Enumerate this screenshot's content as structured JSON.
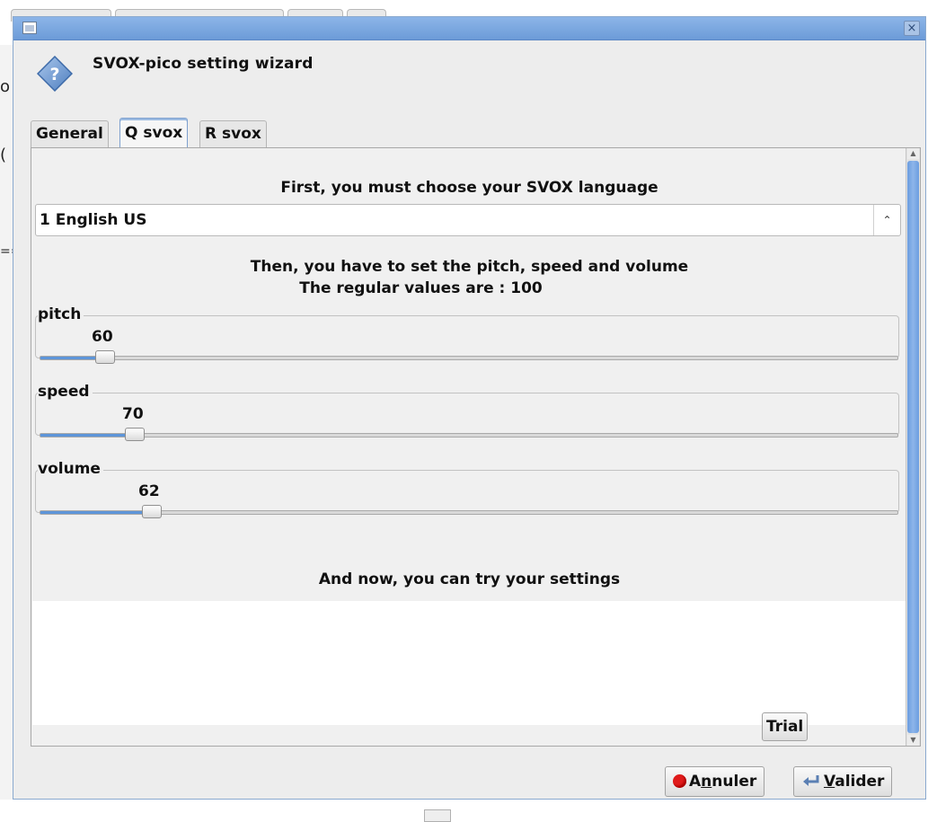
{
  "background": {
    "fragment_o": "o",
    "fragment_paren": "(",
    "fragment_eq": "=="
  },
  "window": {
    "close_glyph": "×"
  },
  "header": {
    "title": "SVOX-pico setting wizard",
    "icon": "question-diamond-icon"
  },
  "tabs": [
    {
      "label": "General",
      "active": false
    },
    {
      "label": "Q svox",
      "active": true
    },
    {
      "label": "R svox",
      "active": false
    }
  ],
  "main": {
    "language_prompt": "First, you must choose your SVOX language",
    "language_value": "1 English US",
    "settings_line1": "Then, you have to set the pitch, speed and volume",
    "settings_line2": "The regular values are : 100",
    "sliders": [
      {
        "label": "pitch",
        "value": "60",
        "level": 0.075
      },
      {
        "label": "speed",
        "value": "70",
        "level": 0.11
      },
      {
        "label": "volume",
        "value": "62",
        "level": 0.13
      }
    ],
    "try_prompt": "And now, you can try your settings",
    "trial_button": "Trial"
  },
  "footer": {
    "cancel_prefix": "A",
    "cancel_mnemonic": "n",
    "cancel_suffix": "nuler",
    "ok_mnemonic": "V",
    "ok_suffix": "alider"
  },
  "colors": {
    "accent": "#5d95d9",
    "titlebar": "#7aa6de",
    "record": "#e01b1b"
  }
}
